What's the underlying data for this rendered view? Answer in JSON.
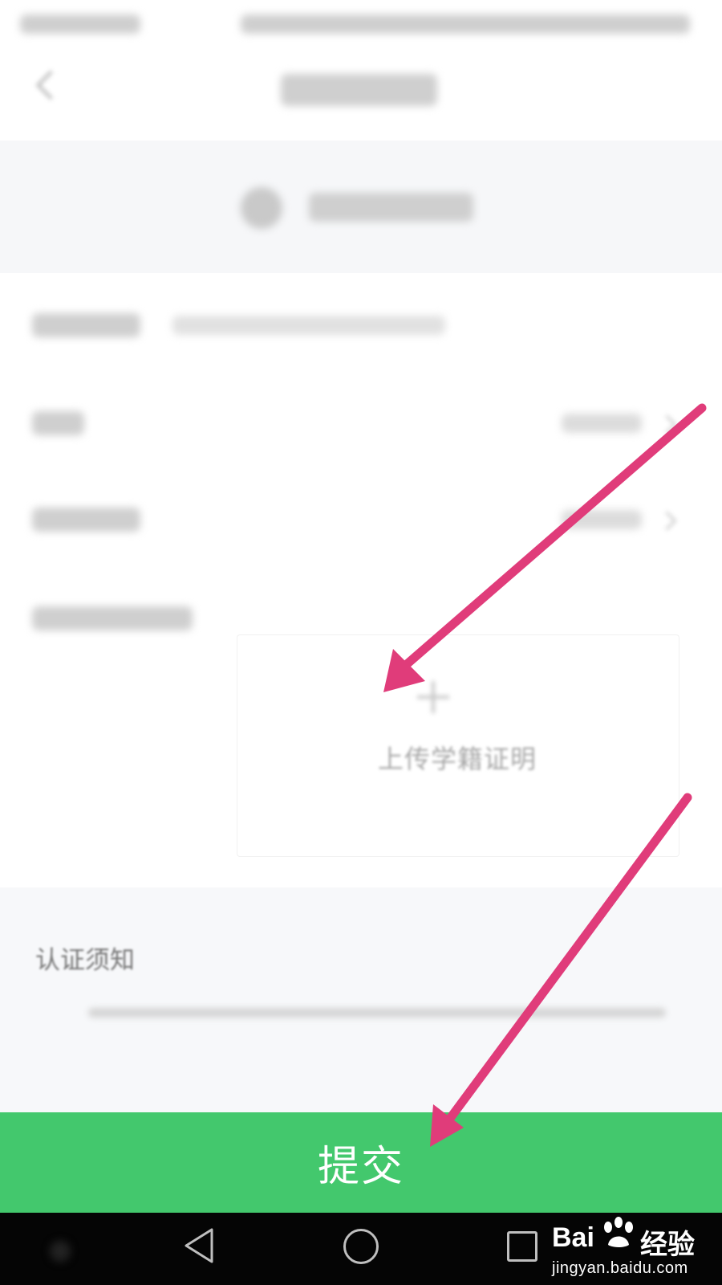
{
  "upload": {
    "label": "上传学籍证明"
  },
  "notice": {
    "title": "认证须知"
  },
  "submit": {
    "label": "提交"
  },
  "watermark": {
    "logo_left": "Bai",
    "logo_right": "经验",
    "url": "jingyan.baidu.com"
  },
  "colors": {
    "submit_green": "#43c86d",
    "arrow_pink": "#e03c7a",
    "notice_background": "#f7f8fa",
    "navbar_black": "#050505"
  },
  "icons": {
    "back": "chevron-left-icon",
    "add": "plus-icon",
    "sys_back": "triangle-back-icon",
    "sys_home": "circle-home-icon",
    "sys_recent": "square-recent-icon"
  }
}
